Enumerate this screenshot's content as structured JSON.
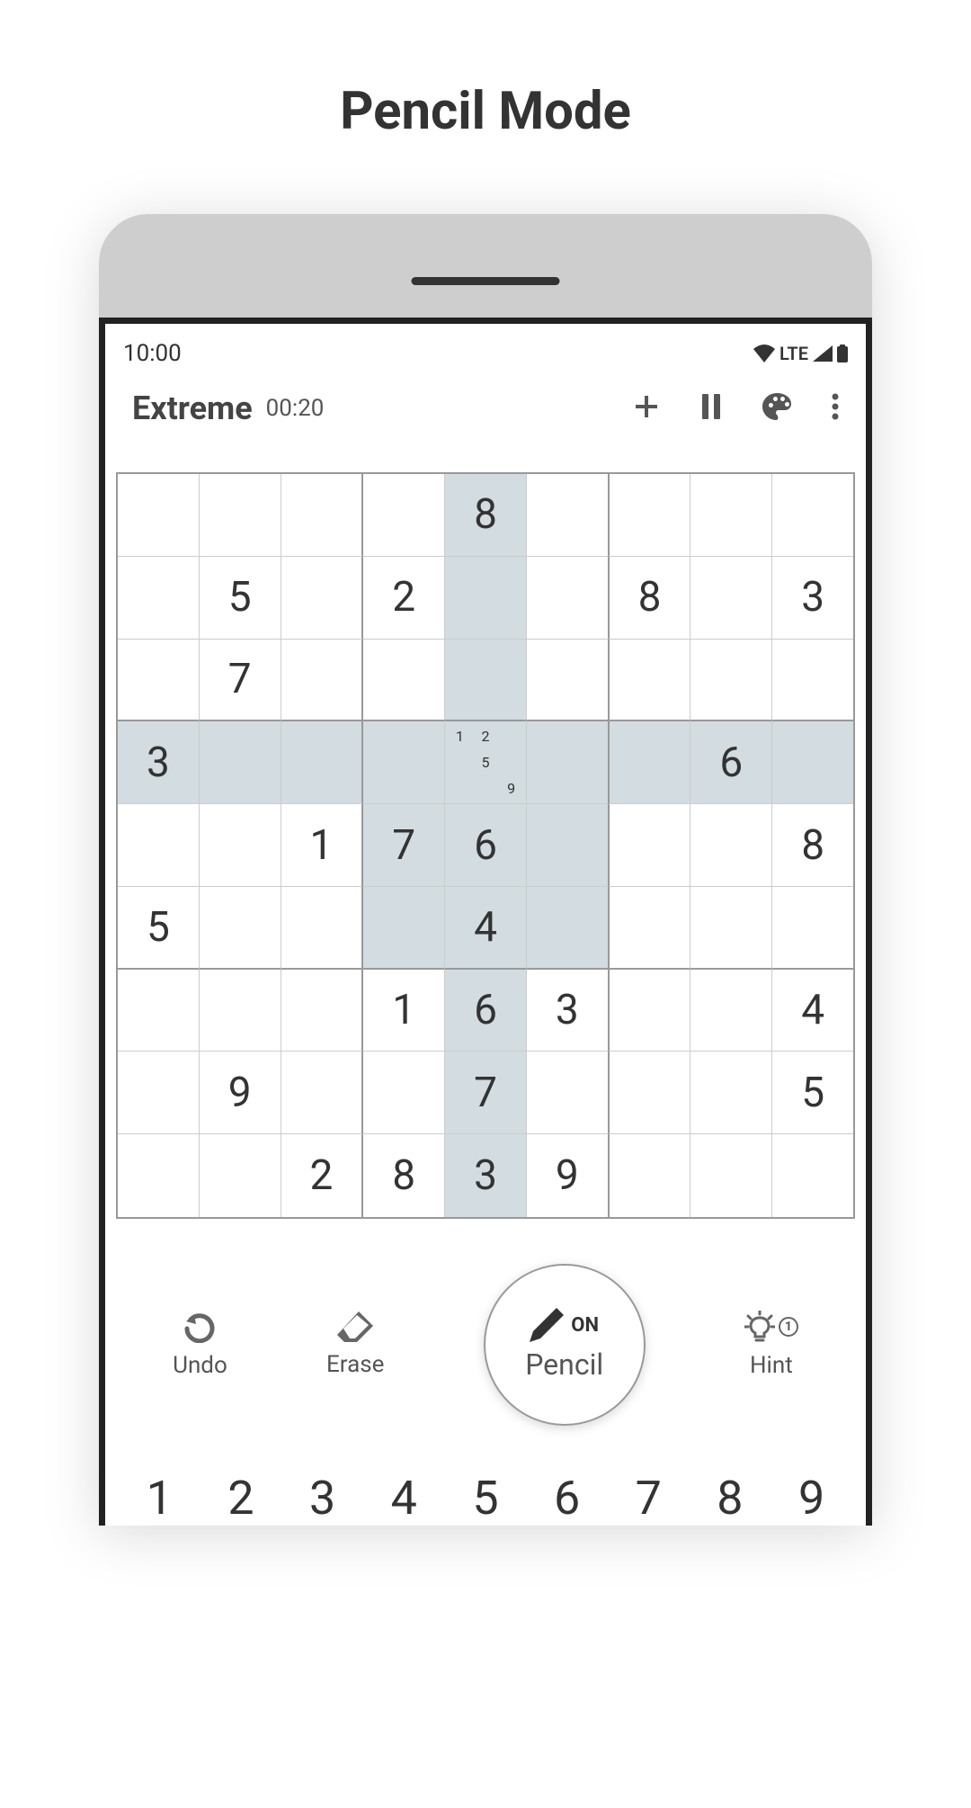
{
  "page_title": "Pencil Mode",
  "status": {
    "time": "10:00",
    "network": "LTE"
  },
  "header": {
    "difficulty": "Extreme",
    "timer": "00:20"
  },
  "sudoku": {
    "selected": {
      "row": 3,
      "col": 4
    },
    "pencil_marks_selected": [
      "1",
      "2",
      "",
      "",
      "5",
      "",
      "",
      "",
      "9"
    ],
    "rows": [
      [
        "",
        "",
        "",
        "",
        "8",
        "",
        "",
        "",
        ""
      ],
      [
        "",
        "5",
        "",
        "2",
        "",
        "",
        "8",
        "",
        "3"
      ],
      [
        "",
        "7",
        "",
        "",
        "",
        "",
        "",
        "",
        ""
      ],
      [
        "3",
        "",
        "",
        "",
        "",
        "",
        "",
        "6",
        ""
      ],
      [
        "",
        "",
        "1",
        "7",
        "6",
        "",
        "",
        "",
        "8"
      ],
      [
        "5",
        "",
        "",
        "",
        "4",
        "",
        "",
        "",
        ""
      ],
      [
        "",
        "",
        "",
        "1",
        "6",
        "3",
        "",
        "",
        "4"
      ],
      [
        "",
        "9",
        "",
        "",
        "7",
        "",
        "",
        "",
        "5"
      ],
      [
        "",
        "",
        "2",
        "8",
        "3",
        "9",
        "",
        "",
        ""
      ]
    ]
  },
  "controls": {
    "undo": "Undo",
    "erase": "Erase",
    "pencil": "Pencil",
    "pencil_state": "ON",
    "hint": "Hint",
    "hint_count": "1"
  },
  "numpad": [
    "1",
    "2",
    "3",
    "4",
    "5",
    "6",
    "7",
    "8",
    "9"
  ]
}
